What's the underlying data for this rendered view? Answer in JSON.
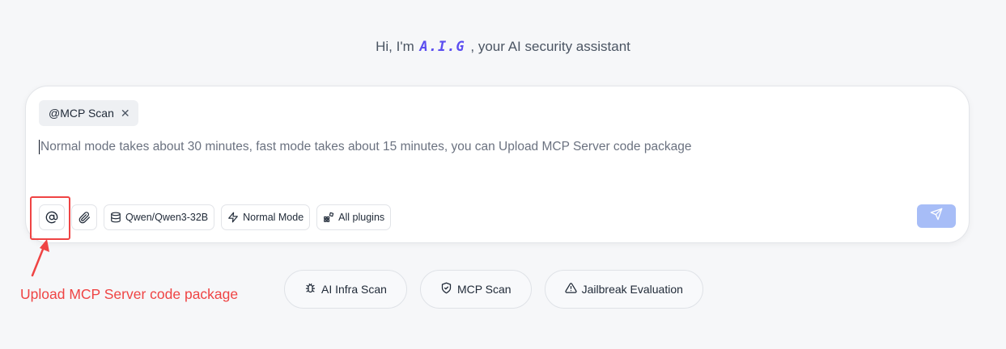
{
  "greeting": {
    "prefix": "Hi, I'm",
    "brand": "A.I.G",
    "suffix": ", your AI security assistant"
  },
  "composer": {
    "tag": "@MCP Scan",
    "placeholder": "Normal mode takes about 30 minutes, fast mode takes about 15 minutes, you can Upload MCP Server code package",
    "toolbar": {
      "mention_icon": "at-sign-icon",
      "attach_icon": "paperclip-icon",
      "model_label": "Qwen/Qwen3-32B",
      "mode_label": "Normal Mode",
      "plugins_label": "All plugins"
    },
    "send_icon": "send-icon"
  },
  "annotation": {
    "text": "Upload MCP Server code package",
    "color": "#ef4444"
  },
  "quick_actions": [
    {
      "label": "AI Infra Scan",
      "icon": "bug-icon"
    },
    {
      "label": "MCP Scan",
      "icon": "shield-icon"
    },
    {
      "label": "Jailbreak Evaluation",
      "icon": "warning-triangle-icon"
    }
  ],
  "colors": {
    "brand": "#5b4ef0",
    "send_button": "#a7bdf7",
    "annotation": "#ef4444"
  }
}
